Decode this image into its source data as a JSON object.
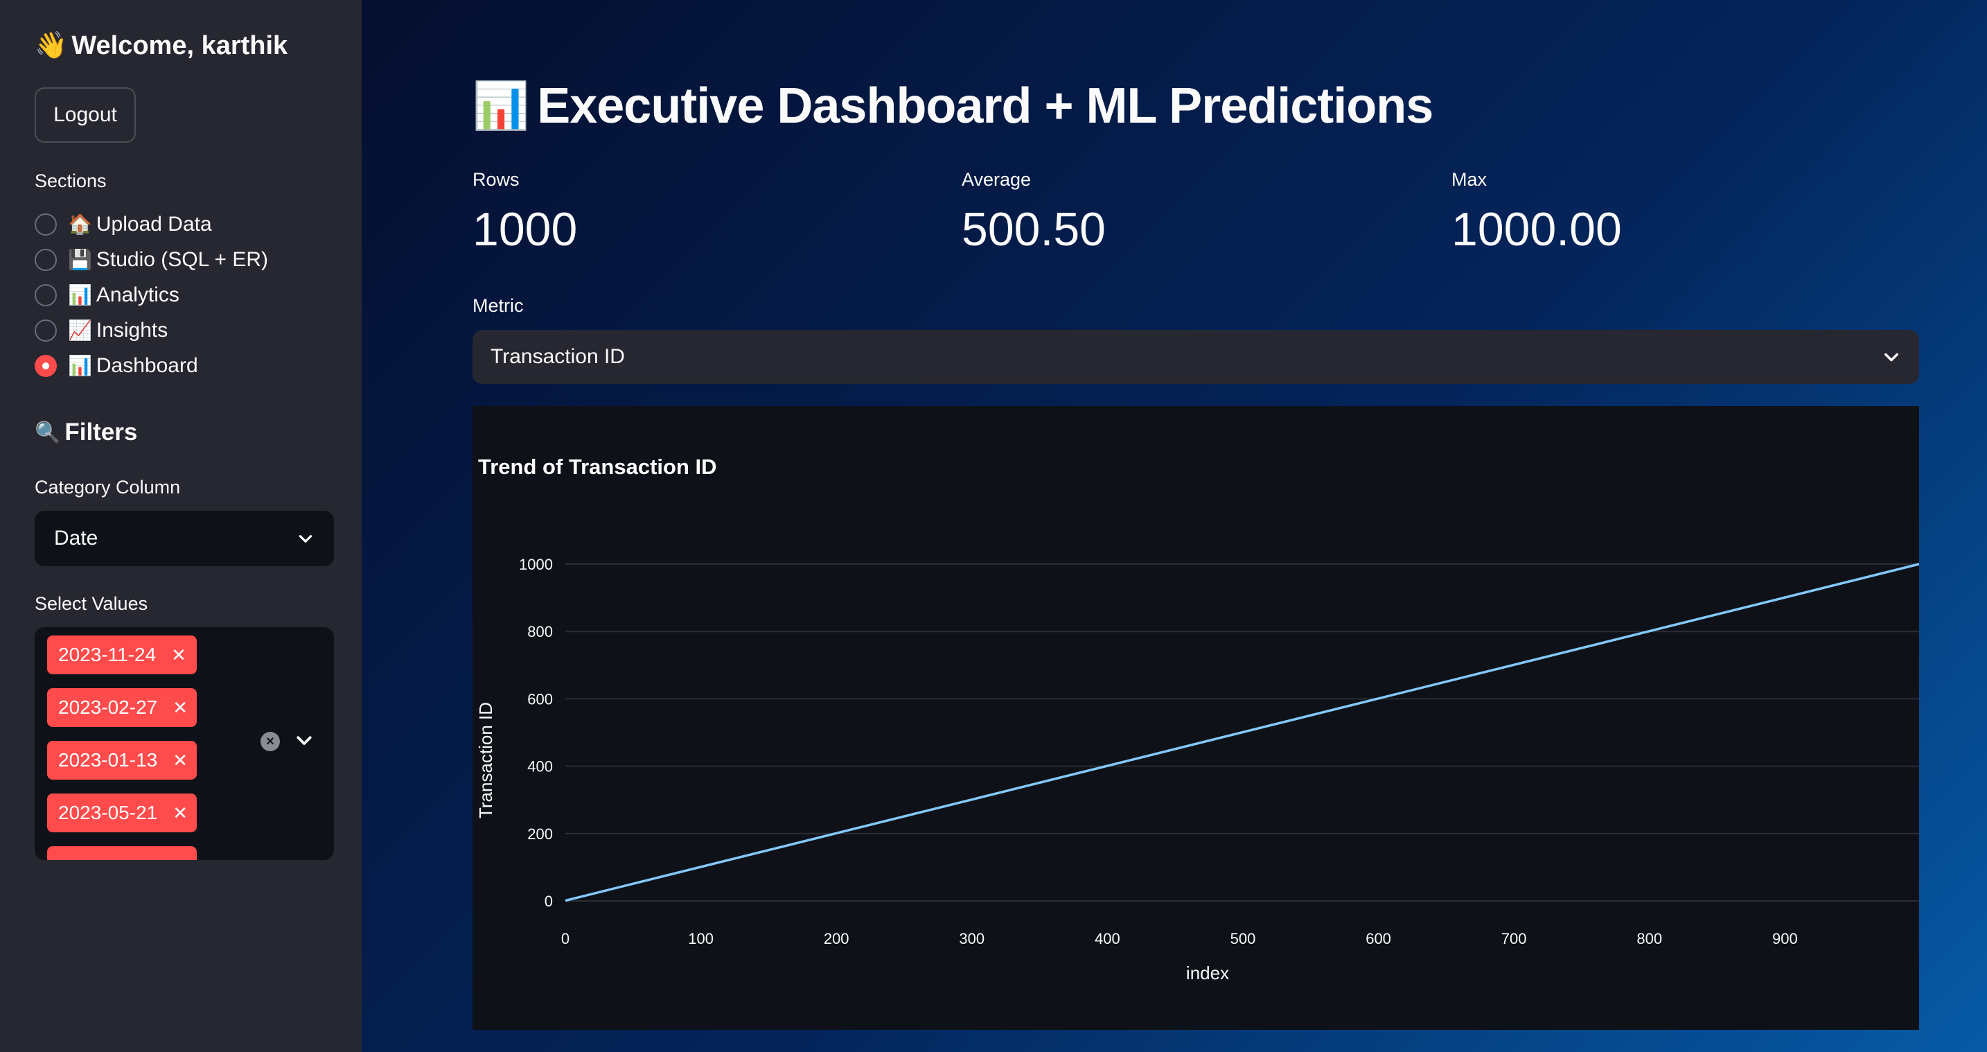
{
  "sidebar": {
    "welcome_emoji": "👋",
    "welcome_text": "Welcome, karthik",
    "logout_label": "Logout",
    "sections_label": "Sections",
    "sections": [
      {
        "emoji": "🏠",
        "label": "Upload Data",
        "selected": false
      },
      {
        "emoji": "💾",
        "label": "Studio (SQL + ER)",
        "selected": false
      },
      {
        "emoji": "📊",
        "label": "Analytics",
        "selected": false
      },
      {
        "emoji": "📈",
        "label": "Insights",
        "selected": false
      },
      {
        "emoji": "📊",
        "label": "Dashboard",
        "selected": true
      }
    ],
    "filters_emoji": "🔍",
    "filters_title": "Filters",
    "category_label": "Category Column",
    "category_value": "Date",
    "select_values_label": "Select Values",
    "selected_values": [
      "2023-11-24",
      "2023-02-27",
      "2023-01-13",
      "2023-05-21"
    ],
    "accent_color": "#ff4b4b"
  },
  "main": {
    "title_emoji": "📊",
    "title": "Executive Dashboard + ML Predictions",
    "metrics": [
      {
        "label": "Rows",
        "value": "1000"
      },
      {
        "label": "Average",
        "value": "500.50"
      },
      {
        "label": "Max",
        "value": "1000.00"
      }
    ],
    "metric_select_label": "Metric",
    "metric_select_value": "Transaction ID"
  },
  "chart_data": {
    "type": "line",
    "title": "Trend of Transaction ID",
    "xlabel": "index",
    "ylabel": "Transaction ID",
    "xlim": [
      0,
      999
    ],
    "ylim": [
      0,
      1000
    ],
    "x_ticks": [
      0,
      100,
      200,
      300,
      400,
      500,
      600,
      700,
      800,
      900
    ],
    "y_ticks": [
      0,
      200,
      400,
      600,
      800,
      1000
    ],
    "grid": true,
    "line_color": "#83c9ff",
    "series": [
      {
        "x": [
          0,
          999
        ],
        "y": [
          1,
          1000
        ]
      }
    ]
  }
}
